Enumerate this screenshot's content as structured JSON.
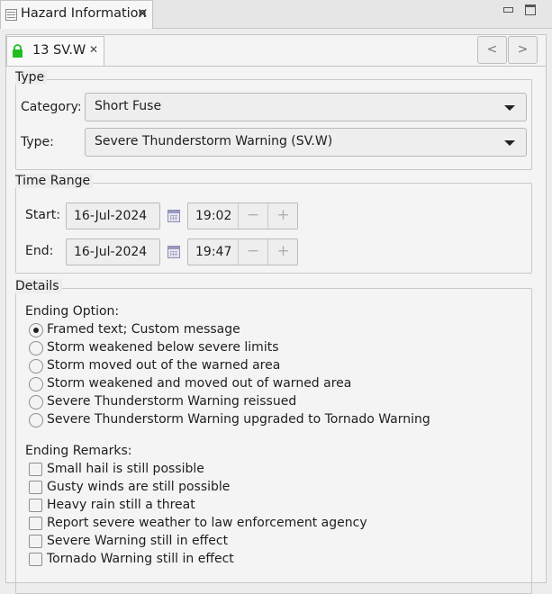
{
  "view_tab": {
    "title": "Hazard Information",
    "close_glyph": "✕"
  },
  "window_controls": {
    "minimize": "minimize-icon",
    "maximize": "maximize-icon"
  },
  "editor_tab": {
    "title": "13 SV.W",
    "close_glyph": "✕"
  },
  "nav": {
    "prev": "<",
    "next": ">"
  },
  "type_group": {
    "title": "Type",
    "category_label": "Category:",
    "category_value": "Short Fuse",
    "type_label": "Type:",
    "type_value": "Severe Thunderstorm Warning (SV.W)"
  },
  "time_range": {
    "title": "Time Range",
    "start_label": "Start:",
    "start_date": "16-Jul-2024",
    "start_time": "19:02",
    "end_label": "End:",
    "end_date": "16-Jul-2024",
    "end_time": "19:47",
    "minus": "−",
    "plus": "+"
  },
  "details": {
    "title": "Details",
    "ending_option_label": "Ending Option:",
    "ending_options": [
      {
        "label": "Framed text; Custom message",
        "selected": true
      },
      {
        "label": "Storm weakened below severe limits",
        "selected": false
      },
      {
        "label": "Storm moved out of the warned area",
        "selected": false
      },
      {
        "label": "Storm weakened and moved out of warned area",
        "selected": false
      },
      {
        "label": "Severe Thunderstorm Warning reissued",
        "selected": false
      },
      {
        "label": "Severe Thunderstorm Warning upgraded to Tornado Warning",
        "selected": false
      }
    ],
    "ending_remarks_label": "Ending Remarks:",
    "ending_remarks": [
      {
        "label": "Small hail is still possible",
        "checked": false
      },
      {
        "label": "Gusty winds are still possible",
        "checked": false
      },
      {
        "label": "Heavy rain still a threat",
        "checked": false
      },
      {
        "label": "Report severe weather to law enforcement agency",
        "checked": false
      },
      {
        "label": "Severe Warning still in effect",
        "checked": false
      },
      {
        "label": "Tornado Warning still in effect",
        "checked": false
      }
    ]
  },
  "colors": {
    "lock": "#1fbf1f",
    "background": "#ededed"
  }
}
